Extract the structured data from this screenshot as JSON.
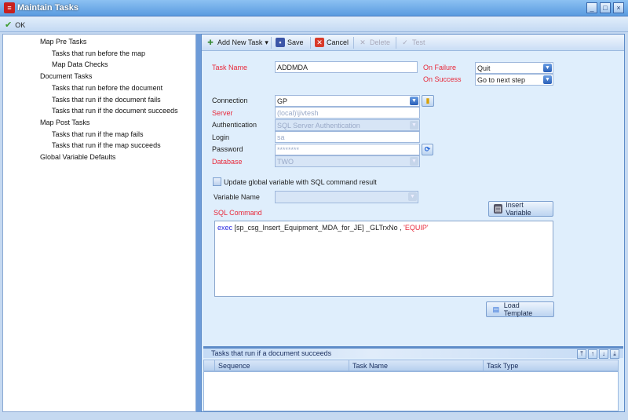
{
  "window": {
    "title": "Maintain Tasks",
    "controls": [
      "_",
      "□",
      "×"
    ]
  },
  "okbar": {
    "ok_label": "OK"
  },
  "tree": [
    {
      "label": "Map Pre Tasks",
      "level": 0
    },
    {
      "label": "Tasks that run before the map",
      "level": 1
    },
    {
      "label": "Map Data Checks",
      "level": 1
    },
    {
      "label": "Document Tasks",
      "level": 0
    },
    {
      "label": "Tasks that run before the document",
      "level": 1
    },
    {
      "label": "Tasks that run if the document fails",
      "level": 1
    },
    {
      "label": "Tasks that run if the document succeeds",
      "level": 1
    },
    {
      "label": "Map Post Tasks",
      "level": 0
    },
    {
      "label": "Tasks that run if the map fails",
      "level": 1
    },
    {
      "label": "Tasks that run if the map succeeds",
      "level": 1
    },
    {
      "label": "Global Variable Defaults",
      "level": 0
    }
  ],
  "toolbar": {
    "add": "Add New Task",
    "save": "Save",
    "cancel": "Cancel",
    "delete": "Delete",
    "test": "Test"
  },
  "form": {
    "task_name_label": "Task Name",
    "task_name": "ADDMDA",
    "on_failure_label": "On Failure",
    "on_failure": "Quit",
    "on_success_label": "On Success",
    "on_success": "Go to next step",
    "connection_label": "Connection",
    "connection": "GP",
    "server_label": "Server",
    "server": "(local)\\jivtesh",
    "auth_label": "Authentication",
    "auth": "SQL Server Authentication",
    "login_label": "Login",
    "login": "sa",
    "password_label": "Password",
    "password": "********",
    "database_label": "Database",
    "database": "TWO",
    "update_label": "Update global variable with SQL command result",
    "varname_label": "Variable Name",
    "varname": "",
    "sql_label": "SQL Command",
    "insert_variable": "Insert Variable",
    "sql": {
      "keyword": "exec",
      "body": " [sp_csg_Insert_Equipment_MDA_for_JE]  _GLTrxNo , ",
      "string": "'EQUIP'"
    },
    "load_template": "Load Template"
  },
  "grid": {
    "title": "Tasks that run if a document succeeds",
    "columns": [
      "Sequence",
      "Task Name",
      "Task Type"
    ],
    "rows": []
  },
  "colors": {
    "accent": "#5e8cc8",
    "required": "#e8293a"
  }
}
